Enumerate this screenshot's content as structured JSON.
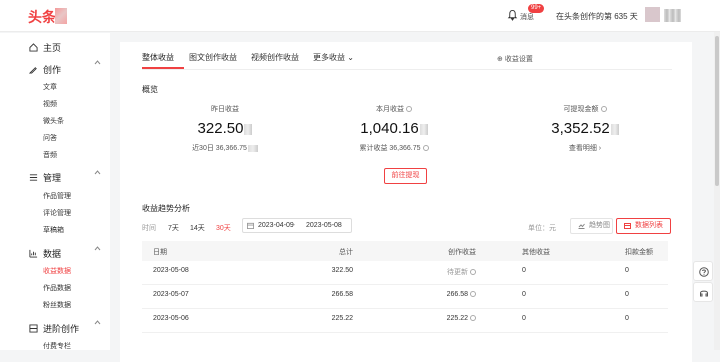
{
  "header": {
    "logo": "头条",
    "messages_label": "消息",
    "messages_badge": "99+",
    "days_text": "在头条创作的第 635 天"
  },
  "sidebar": {
    "home": "主页",
    "create": {
      "title": "创作",
      "items": [
        "文章",
        "视频",
        "微头条",
        "问答",
        "音频"
      ]
    },
    "manage": {
      "title": "管理",
      "items": [
        "作品管理",
        "评论管理",
        "草稿箱"
      ]
    },
    "data": {
      "title": "数据",
      "items": [
        "收益数据",
        "作品数据",
        "粉丝数据"
      ]
    },
    "advanced": {
      "title": "进阶创作",
      "items": [
        "付费专栏"
      ]
    }
  },
  "tabs": [
    "整体收益",
    "图文创作收益",
    "视频创作收益",
    "更多收益"
  ],
  "settings_label": "收益设置",
  "overview": {
    "title": "概览",
    "yesterday": {
      "label": "昨日收益",
      "value": "322.50",
      "sub": "近30日 36,366.75"
    },
    "month": {
      "label": "本月收益",
      "value": "1,040.16",
      "sub": "累计收益 36,366.75"
    },
    "withdrawable": {
      "label": "可提现金额",
      "value": "3,352.52",
      "sub": "查看明细"
    },
    "withdraw_button": "前往提现"
  },
  "trend": {
    "title": "收益趋势分析",
    "time_label": "时间",
    "ranges": [
      "7天",
      "14天",
      "30天"
    ],
    "active_range": "30天",
    "date_start": "2023-04-09",
    "date_sep": "-",
    "date_end": "2023-05-08",
    "unit": "单位：元",
    "view_trend": "趋势图",
    "view_list": "数据列表"
  },
  "table": {
    "columns": [
      "日期",
      "总计",
      "创作收益",
      "其他收益",
      "扣款金额"
    ],
    "rows": [
      {
        "date": "2023-05-08",
        "total": "322.50",
        "create": "待更新",
        "other": "0",
        "deduct": "0"
      },
      {
        "date": "2023-05-07",
        "total": "266.58",
        "create": "266.58",
        "other": "0",
        "deduct": "0"
      },
      {
        "date": "2023-05-06",
        "total": "225.22",
        "create": "225.22",
        "other": "0",
        "deduct": "0"
      }
    ]
  },
  "colors": {
    "accent": "#f04142",
    "background": "#f4f5f6"
  }
}
